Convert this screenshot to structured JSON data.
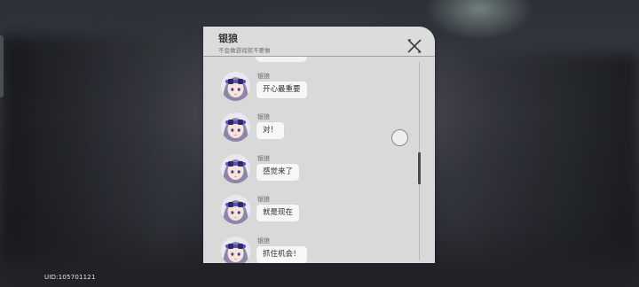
{
  "screen": {
    "uid_text": "UID:105701121"
  },
  "chat": {
    "title": "银狼",
    "subtitle": "不会做游戏就不要做",
    "close_icon": "close-x-icon",
    "scroll_down_icon": "chevron-down-double-icon",
    "messages": [
      {
        "sender": "银狼",
        "text": "开心最重要"
      },
      {
        "sender": "银狼",
        "text": "对！"
      },
      {
        "sender": "银狼",
        "text": "感觉来了"
      },
      {
        "sender": "银狼",
        "text": "就是现在"
      },
      {
        "sender": "银狼",
        "text": "抓住机会！"
      }
    ]
  },
  "colors": {
    "panel_bg": "#d9d9d9",
    "bubble_bg": "#f7f7f7",
    "avatar_hair": "#8e86a8",
    "avatar_accent": "#5b4fd6"
  }
}
